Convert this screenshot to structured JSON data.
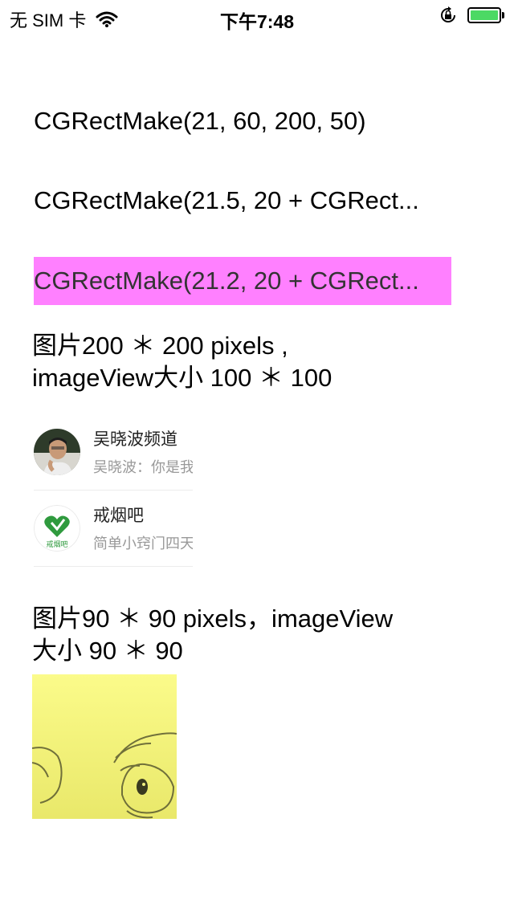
{
  "status_bar": {
    "carrier": "无 SIM 卡",
    "time": "下午7:48",
    "battery_color": "#4cd964"
  },
  "labels": {
    "label1": "CGRectMake(21, 60, 200, 50)",
    "label2": "CGRectMake(21.5, 20 + CGRect...",
    "label3": "CGRectMake(21.2, 20 + CGRect...",
    "label3_background": "#ff80ff"
  },
  "captions": {
    "caption1_line1": "图片200 ＊ 200 pixels ,",
    "caption1_line2": "imageView大小 100 ＊ 100",
    "caption2_line1": "图片90 ＊ 90 pixels，imageView",
    "caption2_line2": "大小 90 ＊ 90"
  },
  "list": [
    {
      "title": "吴晓波频道",
      "subtitle": "吴晓波：你是我",
      "avatar": "person-avatar-icon"
    },
    {
      "title": "戒烟吧",
      "subtitle": "简单小窍门四天",
      "avatar": "heart-logo-icon",
      "logo_text": "戒烟吧"
    }
  ]
}
